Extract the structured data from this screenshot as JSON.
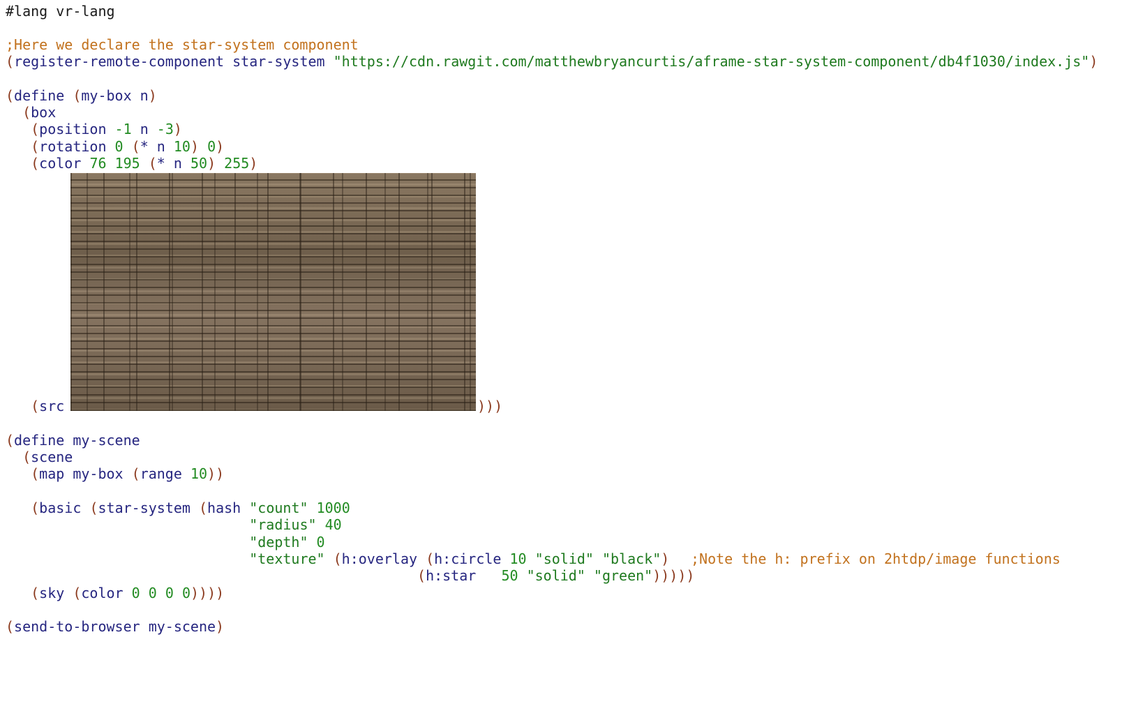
{
  "lang": "#lang vr-lang",
  "comment1": ";Here we declare the star-system component",
  "reg": {
    "fn": "register-remote-component",
    "name": "star-system",
    "url": "\"https://cdn.rawgit.com/matthewbryancurtis/aframe-star-system-component/db4f1030/index.js\""
  },
  "def1": {
    "kw": "define",
    "sig": "my-box n"
  },
  "box": "box",
  "position": {
    "kw": "position",
    "a": "-1",
    "b": "n",
    "c": "-3"
  },
  "rotation": {
    "kw": "rotation",
    "a": "0",
    "op": "*",
    "b": "n",
    "c": "10",
    "d": "0"
  },
  "color": {
    "kw": "color",
    "r": "76",
    "g": "195",
    "op": "*",
    "n": "n",
    "m": "50",
    "a": "255"
  },
  "src": {
    "kw": "src"
  },
  "def2": {
    "kw": "define",
    "name": "my-scene"
  },
  "scene": "scene",
  "map": {
    "kw": "map",
    "fn": "my-box",
    "range": "range",
    "n": "10"
  },
  "basic": {
    "kw": "basic",
    "sys": "star-system",
    "hash": "hash"
  },
  "count": {
    "key": "\"count\"",
    "val": "1000"
  },
  "radius": {
    "key": "\"radius\"",
    "val": "40"
  },
  "depth": {
    "key": "\"depth\"",
    "val": "0"
  },
  "texture": {
    "key": "\"texture\"",
    "overlay": "h:overlay",
    "circle": "h:circle",
    "circle_n": "10",
    "solid1": "\"solid\"",
    "black": "\"black\"",
    "star": "h:star",
    "star_n": "50",
    "solid2": "\"solid\"",
    "green": "\"green\""
  },
  "comment2": ";Note the h: prefix on 2htdp/image functions",
  "sky": {
    "kw": "sky",
    "color": "color",
    "r": "0",
    "g": "0",
    "b": "0",
    "a": "0"
  },
  "send": {
    "kw": "send-to-browser",
    "arg": "my-scene"
  }
}
